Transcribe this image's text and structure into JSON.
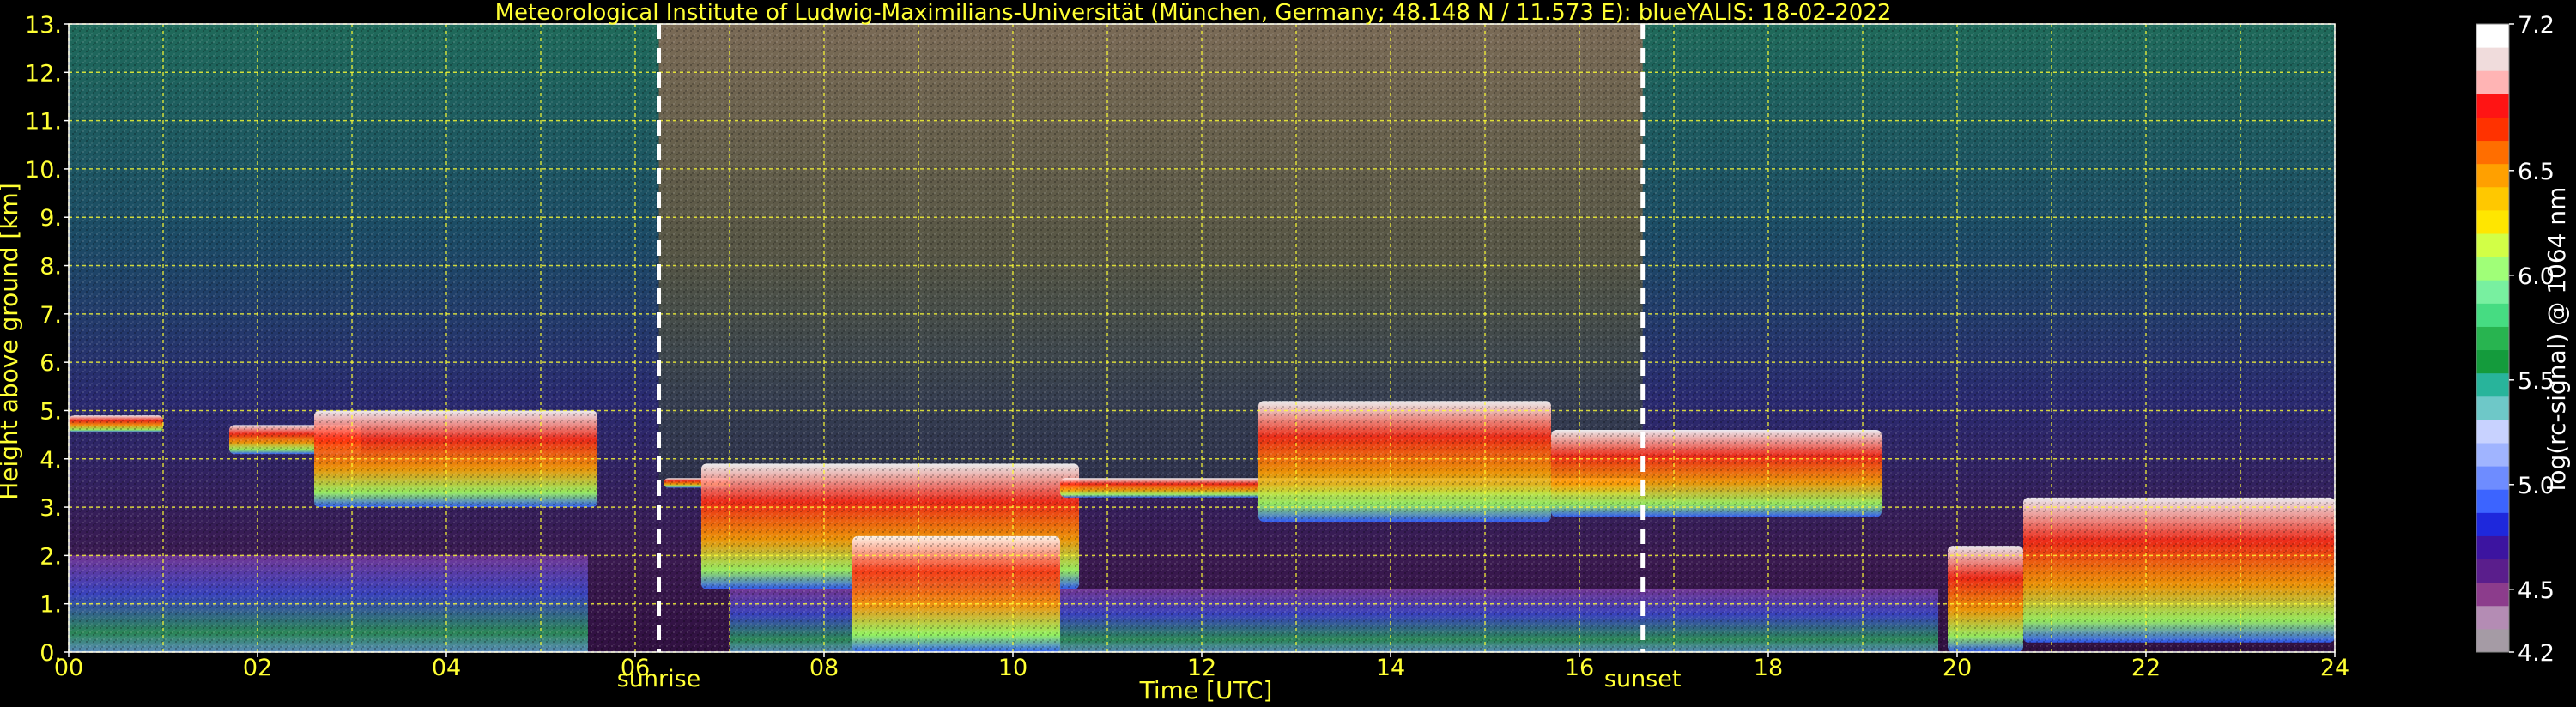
{
  "chart_data": {
    "type": "heatmap",
    "title": "Meteorological Institute of Ludwig-Maximilians-Universität (München, Germany; 48.148 N / 11.573 E):     blueYALIS: 18-02-2022",
    "xlabel": "Time [UTC]",
    "ylabel": "Height above ground [km]",
    "xlim": [
      0,
      24
    ],
    "ylim": [
      0,
      13
    ],
    "x_ticks": [
      "00",
      "02",
      "04",
      "06",
      "08",
      "10",
      "12",
      "14",
      "16",
      "18",
      "20",
      "22",
      "24"
    ],
    "y_ticks": [
      "0.",
      "1.",
      "2.",
      "3.",
      "4.",
      "5.",
      "6.",
      "7.",
      "8.",
      "9.",
      "10.",
      "11.",
      "12.",
      "13."
    ],
    "grid": true,
    "markers": [
      {
        "label": "sunrise",
        "x": 6.25
      },
      {
        "label": "sunset",
        "x": 16.67
      }
    ],
    "colorbar": {
      "label": "log(rc-signal) @ 1064 nm",
      "range": [
        4.2,
        7.2
      ],
      "ticks": [
        "4.2",
        "4.5",
        "5.0",
        "5.5",
        "6.0",
        "6.5",
        "7.2"
      ],
      "colors": [
        "#a59ba5",
        "#b48cb4",
        "#8c3c8c",
        "#5a1e8c",
        "#3c14a0",
        "#1e28dc",
        "#3c64ff",
        "#6e8cff",
        "#a0b4ff",
        "#c8d2ff",
        "#6ec8c8",
        "#28b49b",
        "#149b3c",
        "#28b450",
        "#46dc82",
        "#78f0a0",
        "#a0ff78",
        "#d2ff46",
        "#ffe600",
        "#ffc800",
        "#ffa000",
        "#ff6e00",
        "#ff3200",
        "#ff1414",
        "#ffb4b4",
        "#f0dcdc",
        "#ffffff"
      ]
    },
    "cloud_layers": [
      {
        "start": 0.0,
        "end": 1.0,
        "base": 4.55,
        "top": 4.9
      },
      {
        "start": 1.7,
        "end": 3.1,
        "base": 4.1,
        "top": 4.7
      },
      {
        "start": 2.6,
        "end": 5.6,
        "base": 3.0,
        "top": 5.0
      },
      {
        "start": 6.3,
        "end": 7.0,
        "base": 3.4,
        "top": 3.6
      },
      {
        "start": 6.7,
        "end": 10.7,
        "base": 1.3,
        "top": 3.9
      },
      {
        "start": 8.3,
        "end": 10.5,
        "base": 0.0,
        "top": 2.4
      },
      {
        "start": 10.5,
        "end": 16.7,
        "base": 3.2,
        "top": 3.6
      },
      {
        "start": 12.6,
        "end": 15.7,
        "base": 2.7,
        "top": 5.2
      },
      {
        "start": 15.7,
        "end": 19.2,
        "base": 2.8,
        "top": 4.6
      },
      {
        "start": 19.9,
        "end": 20.7,
        "base": 0.0,
        "top": 2.2
      },
      {
        "start": 20.7,
        "end": 24.0,
        "base": 0.2,
        "top": 3.2
      }
    ],
    "boundary_layer": [
      {
        "start": 0.0,
        "end": 5.5,
        "top": 2.0
      },
      {
        "start": 7.0,
        "end": 19.8,
        "top": 1.3
      }
    ]
  }
}
